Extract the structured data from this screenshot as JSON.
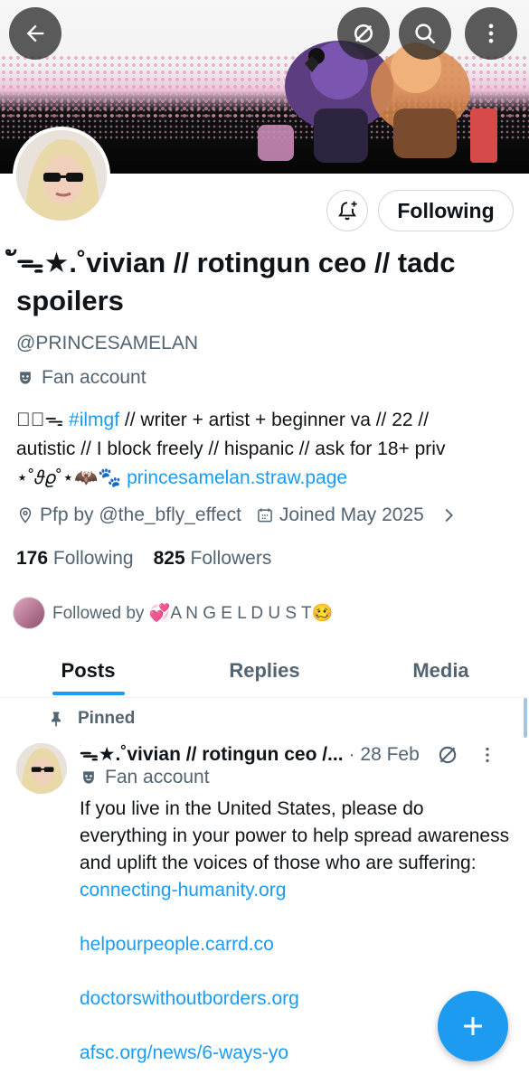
{
  "profile": {
    "display_name": "ัᯓ★.˚vivian // rotingun ceo // tadc spoilers",
    "handle": "@PRINCESAMELAN",
    "category": "Fan account",
    "follow_button": "Following",
    "bio": {
      "line1_prefix": "❤ัᯓ ",
      "hashtag": "#ilmgf",
      "line1_rest": " // writer + artist + beginner va // 22 //",
      "line2": "autistic // I block freely // hispanic // ask for 18+ priv",
      "line3_prefix": "⋆˚𝜗𝜚˚⋆🦇🐾 ",
      "link": "princesamelan.straw.page"
    },
    "location": "Pfp by @the_bfly_effect",
    "joined": "Joined May 2025",
    "following_count": "176",
    "following_label": "Following",
    "followers_count": "825",
    "followers_label": "Followers",
    "followed_by": "Followed by 💞A N G E L D U S T🥴"
  },
  "tabs": [
    "Posts",
    "Replies",
    "Media"
  ],
  "pinned_label": "Pinned",
  "post": {
    "name": "ัᯓ★.˚vivian // rotingun ceo /...",
    "date": "· 28 Feb",
    "category": "Fan account",
    "text": "If you live in the United States, please do everything in your power to help spread awareness and uplift the voices of those who are suffering:",
    "links": [
      "connecting-humanity.org",
      "helpourpeople.carrd.co",
      "doctorswithoutborders.org",
      "afsc.org/news/6-ways-yo"
    ]
  },
  "colors": {
    "accent": "#1d9bf0",
    "muted": "#536471",
    "text": "#0f1419"
  }
}
